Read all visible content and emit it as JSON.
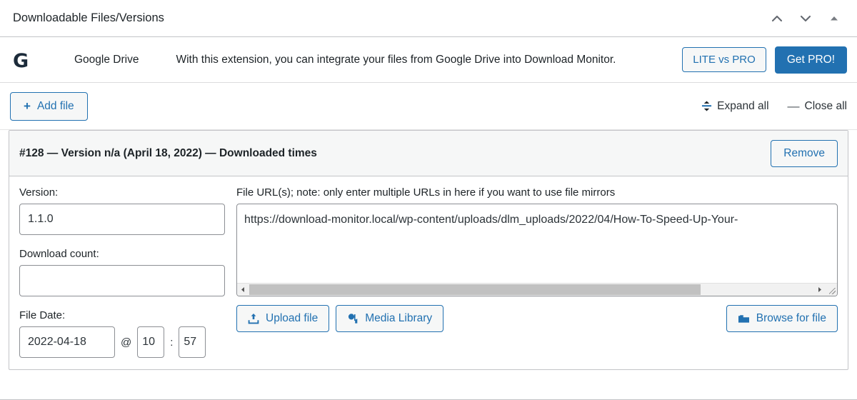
{
  "postbox": {
    "title": "Downloadable Files/Versions",
    "actions": [
      {
        "name": "move-up-icon",
        "label": "Move up"
      },
      {
        "name": "move-down-icon",
        "label": "Move down"
      },
      {
        "name": "toggle-panel-icon",
        "label": "Toggle panel"
      }
    ]
  },
  "gdrive": {
    "logo_letter": "G",
    "name": "Google Drive",
    "description": "With this extension, you can integrate your files from Google Drive into Download Monitor.",
    "lite_vs_pro_label": "LITE vs PRO",
    "get_pro_label": "Get PRO!"
  },
  "toolbar": {
    "add_file_label": "Add file",
    "add_file_plus": "+",
    "expand_all_label": "Expand all",
    "close_all_label": "Close all",
    "close_all_dash": "—"
  },
  "file": {
    "header_id": "#128",
    "header_rest": " — Version n/a (April 18, 2022) — Downloaded times",
    "remove_label": "Remove",
    "version": {
      "label": "Version:",
      "value": "1.1.0",
      "placeholder": ""
    },
    "download_count": {
      "label": "Download count:",
      "value": "",
      "placeholder": ""
    },
    "file_date": {
      "label": "File Date:",
      "value": "2022-04-18",
      "at": "@",
      "hour": "10",
      "colon": ":",
      "minute": "57"
    },
    "file_urls": {
      "label": "File URL(s); note: only enter multiple URLs in here if you want to use file mirrors",
      "value": "https://download-monitor.local/wp-content/uploads/dlm_uploads/2022/04/How-To-Speed-Up-Your-",
      "scroll_thumb_percent": 80
    },
    "upload_file_label": "Upload file",
    "media_library_label": "Media Library",
    "browse_for_file_label": "Browse for file"
  },
  "colors": {
    "accent_blue": "#2271b1",
    "panel_border": "#c3c4c7",
    "header_bg": "#f6f7f7",
    "text": "#1d2327"
  }
}
